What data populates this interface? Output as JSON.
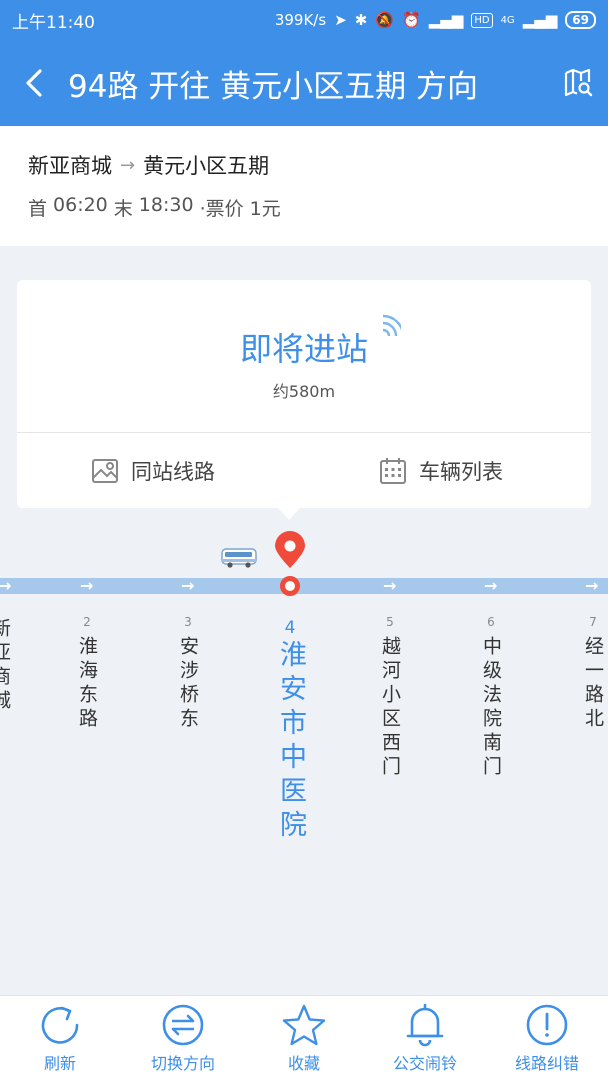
{
  "status_bar": {
    "time": "上午11:40",
    "speed": "399K/s",
    "hd": "HD",
    "net": "4G",
    "battery": "69"
  },
  "header": {
    "title": "94路 开往 黄元小区五期 方向"
  },
  "route": {
    "from": "新亚商城",
    "arrow": "→",
    "to": "黄元小区五期",
    "first_label": "首",
    "first_time": "06:20",
    "last_label": "末",
    "last_time": "18:30",
    "fare": "·票价 1元"
  },
  "arrival": {
    "status": "即将进站",
    "distance": "约580m"
  },
  "actions": {
    "same_station": "同站线路",
    "vehicle_list": "车辆列表"
  },
  "stops": [
    {
      "num": "",
      "name": "新亚商城"
    },
    {
      "num": "2",
      "name": "淮海东路"
    },
    {
      "num": "3",
      "name": "安涉桥东"
    },
    {
      "num": "4",
      "name": "淮安市中医院"
    },
    {
      "num": "5",
      "name": "越河小区西门"
    },
    {
      "num": "6",
      "name": "中级法院南门"
    },
    {
      "num": "7",
      "name": "经一路北"
    }
  ],
  "tabs": [
    {
      "label": "刷新",
      "icon": "refresh-icon"
    },
    {
      "label": "切换方向",
      "icon": "switch-direction-icon"
    },
    {
      "label": "收藏",
      "icon": "star-icon"
    },
    {
      "label": "公交闹铃",
      "icon": "bell-icon"
    },
    {
      "label": "线路纠错",
      "icon": "alert-icon"
    }
  ],
  "colors": {
    "primary": "#3d8fe8",
    "track": "#a6c8ea",
    "pin": "#f04a3a",
    "background": "#eef2f6"
  }
}
